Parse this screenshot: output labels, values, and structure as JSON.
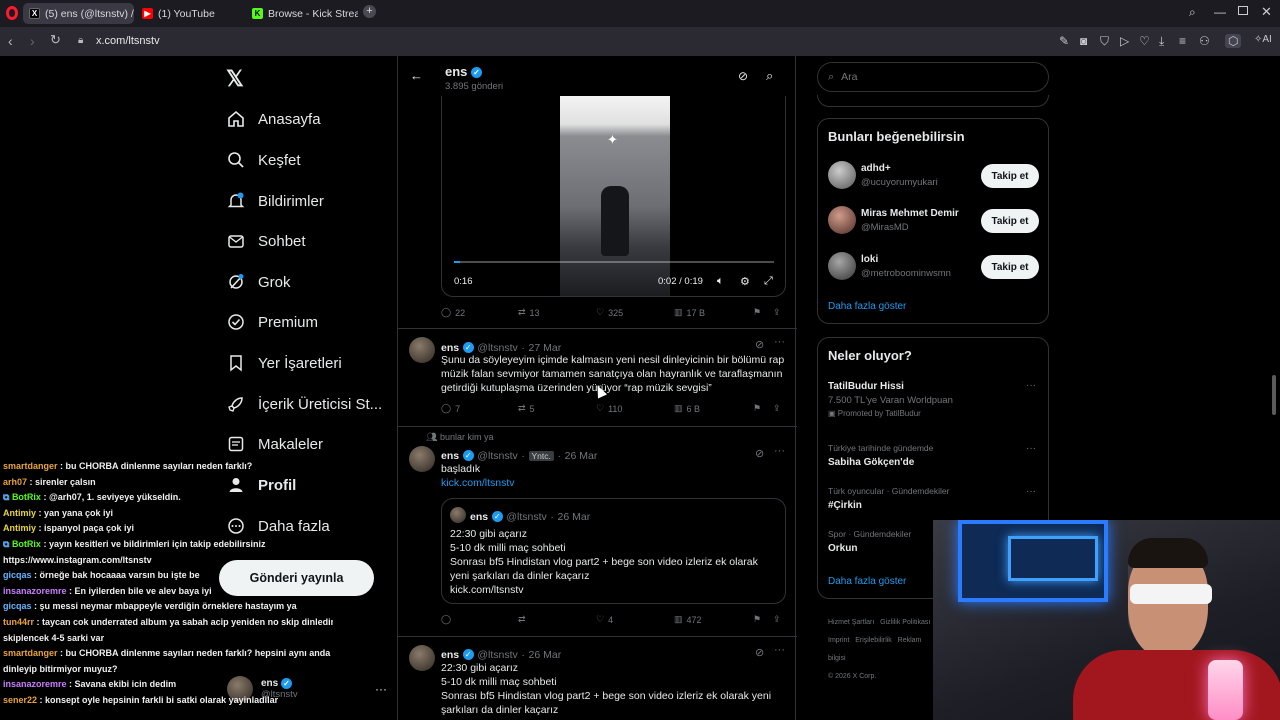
{
  "browser": {
    "tabs": [
      {
        "label": "(5) ens (@ltsnstv) / X",
        "icon": "x-logo-icon"
      },
      {
        "label": "(1) YouTube",
        "icon": "youtube-icon"
      },
      {
        "label": "Browse - Kick Streaming",
        "icon": "kick-icon"
      }
    ],
    "url": "x.com/ltsnstv",
    "ai_label": "AI"
  },
  "nav": {
    "items": [
      {
        "label": "Anasayfa",
        "icon": "home-icon"
      },
      {
        "label": "Keşfet",
        "icon": "search-icon"
      },
      {
        "label": "Bildirimler",
        "icon": "bell-icon"
      },
      {
        "label": "Sohbet",
        "icon": "mail-icon"
      },
      {
        "label": "Grok",
        "icon": "grok-icon"
      },
      {
        "label": "Premium",
        "icon": "premium-icon"
      },
      {
        "label": "Yer İşaretleri",
        "icon": "bookmark-icon"
      },
      {
        "label": "İçerik Üreticisi St...",
        "icon": "rocket-icon"
      },
      {
        "label": "Makaleler",
        "icon": "article-icon"
      },
      {
        "label": "Profil",
        "icon": "person-icon"
      },
      {
        "label": "Daha fazla",
        "icon": "more-icon"
      }
    ],
    "post_button": "Gönderi yayınla",
    "account": {
      "name": "ens",
      "handle": "@ltsnstv"
    }
  },
  "header": {
    "name": "ens",
    "posts": "3.895 gönderi"
  },
  "video_post": {
    "time_left": "0:16",
    "time_total": "0:02 / 0:19",
    "stats": {
      "replies": "22",
      "reposts": "13",
      "likes": "325",
      "views": "17 B"
    }
  },
  "tweets": [
    {
      "name": "ens",
      "handle": "@ltsnstv",
      "date": "27 Mar",
      "text": "Şunu da söyleyeyim içimde kalmasın yeni nesil dinleyicinin bir bölümü rap müzik falan sevmiyor tamamen sanatçıya olan hayranlık ve taraflaşmanın getirdiği kutuplaşma üzerinden yürüyor “rap müzik sevgisi”",
      "stats": {
        "replies": "7",
        "reposts": "5",
        "likes": "110",
        "views": "6 B"
      }
    },
    {
      "context": "bunlar kim ya",
      "name": "ens",
      "handle": "@ltsnstv",
      "badge": "Yntc.",
      "date": "26 Mar",
      "text": "başladık",
      "link": "kick.com/ltsnstv",
      "quote": {
        "name": "ens",
        "handle": "@ltsnstv",
        "date": "26 Mar",
        "lines": [
          "22:30 gibi açarız",
          "5-10 dk milli maç sohbeti",
          "Sonrası bf5 Hindistan vlog part2 + bege son video izleriz ek olarak yeni şarkıları da dinler kaçarız",
          "kick.com/ltsnstv"
        ]
      },
      "stats": {
        "replies": "",
        "reposts": "",
        "likes": "4",
        "views": "472"
      }
    },
    {
      "name": "ens",
      "handle": "@ltsnstv",
      "date": "26 Mar",
      "lines": [
        "22:30 gibi açarız",
        "5-10 dk milli maç sohbeti",
        "Sonrası bf5 Hindistan vlog part2 + bege son video izleriz ek olarak yeni",
        "şarkıları da dinler kaçarız"
      ]
    }
  ],
  "search": {
    "placeholder": "Ara"
  },
  "who_to_follow": {
    "title": "Bunları beğenebilirsin",
    "users": [
      {
        "name": "adhd+",
        "handle": "@ucuyorumyukari",
        "button": "Takip et"
      },
      {
        "name": "Miras Mehmet Demir",
        "handle": "@MirasMD",
        "button": "Takip et"
      },
      {
        "name": "loki",
        "handle": "@metroboominwsmn",
        "button": "Takip et"
      }
    ],
    "more": "Daha fazla göster"
  },
  "trends": {
    "title": "Neler oluyor?",
    "items": [
      {
        "context": "",
        "name": "TatilBudur Hissi",
        "sub": "7.500 TL'ye Varan Worldpuan",
        "promo": "Promoted by TatilBudur"
      },
      {
        "context": "Türkiye tarihinde gündemde",
        "name": "Sabiha Gökçen'de"
      },
      {
        "context": "Türk oyuncular · Gündemdekiler",
        "name": "#Çirkin"
      },
      {
        "context": "Spor · Gündemdekiler",
        "name": "Orkun"
      }
    ],
    "more": "Daha fazla göster",
    "footer": [
      "Hizmet Şartları",
      "Gizlilik Politikası",
      "Imprint",
      "Erişilebilirlik",
      "Reklam bilgisi",
      "© 2026 X Corp."
    ]
  },
  "chat": [
    {
      "user": "smartdanger",
      "color": "#e8a33c",
      "msg": "bu CHORBA dinlenme sayıları neden farklı?"
    },
    {
      "user": "arh07",
      "color": "#e8a33c",
      "msg": "sirenler çalsın"
    },
    {
      "user": "BotRix",
      "color": "#53fc18",
      "msg": "@arh07, 1. seviyeye yükseldin.",
      "bot": true
    },
    {
      "user": "Antimiy",
      "color": "#e8d43c",
      "msg": "yan yana çok iyi"
    },
    {
      "user": "Antimiy",
      "color": "#e8d43c",
      "msg": "ispanyol paça çok iyi"
    },
    {
      "user": "BotRix",
      "color": "#53fc18",
      "msg": "yayın kesitleri ve bildirimleri için takip edebilirsiniz",
      "bot": true
    },
    {
      "user": "",
      "color": "#ffffff",
      "msg": "https://www.instagram.com/ltsnstv"
    },
    {
      "user": "gicqas",
      "color": "#5fb7ff",
      "msg": "örneğe bak hocaaaa varsın bu işte be"
    },
    {
      "user": "insanazoremre",
      "color": "#c87cff",
      "msg": "En iyilerden bile ve alev baya iyi"
    },
    {
      "user": "gicqas",
      "color": "#5fb7ff",
      "msg": "şu messi neymar mbappeyle verdiğin örneklere hastayım ya"
    },
    {
      "user": "tun44rr",
      "color": "#e8a33c",
      "msg": "taycan cok underrated album ya sabah acip yeniden no skip dinledim"
    },
    {
      "user": "",
      "color": "#ffffff",
      "msg": "skiplencek 4-5 sarki var"
    },
    {
      "user": "smartdanger",
      "color": "#e8a33c",
      "msg": "bu CHORBA dinlenme sayıları neden farklı? hepsini aynı anda"
    },
    {
      "user": "",
      "color": "#ffffff",
      "msg": "dinleyip bitirmiyor muyuz?"
    },
    {
      "user": "insanazoremre",
      "color": "#c87cff",
      "msg": "Savana ekibi icin dedim"
    },
    {
      "user": "sener22",
      "color": "#e8a33c",
      "msg": "konsept oyle hepsinin farkli bi satki olarak yayinladilar"
    }
  ]
}
